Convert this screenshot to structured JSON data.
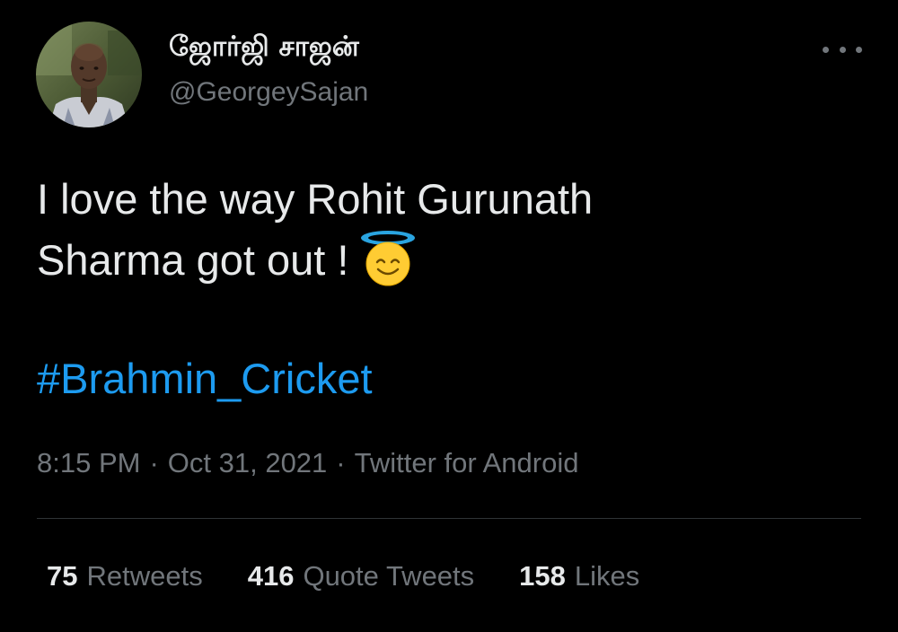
{
  "author": {
    "display_name": "ஜோர்ஜி சாஜன்",
    "handle": "@GeorgeySajan"
  },
  "tweet": {
    "text_lines": [
      "I love the way Rohit Gurunath",
      "Sharma got out !"
    ],
    "emoji": "smiling-face-with-halo",
    "hashtag": "#Brahmin_Cricket",
    "time": "8:15 PM",
    "date": "Oct 31, 2021",
    "source": "Twitter for Android",
    "separator": "·"
  },
  "stats": {
    "retweets": {
      "count": "75",
      "label": "Retweets"
    },
    "quotes": {
      "count": "416",
      "label": "Quote Tweets"
    },
    "likes": {
      "count": "158",
      "label": "Likes"
    }
  },
  "colors": {
    "background": "#000000",
    "text": "#e7e9ea",
    "muted": "#71767b",
    "link": "#1d9bf0",
    "divider": "#2f3336"
  },
  "icons": {
    "more": "more-horizontal-icon",
    "emoji": "halo-smile-emoji-icon"
  }
}
